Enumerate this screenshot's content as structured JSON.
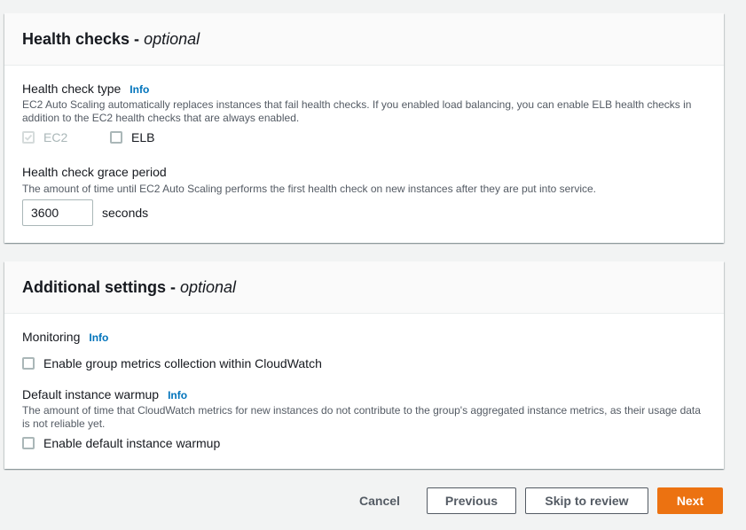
{
  "health_checks": {
    "title": "Health checks - ",
    "title_optional": "optional",
    "type_label": "Health check type",
    "type_info": "Info",
    "type_desc": "EC2 Auto Scaling automatically replaces instances that fail health checks. If you enabled load balancing, you can enable ELB health checks in addition to the EC2 health checks that are always enabled.",
    "ec2_label": "EC2",
    "ec2_checked": true,
    "elb_label": "ELB",
    "elb_checked": false,
    "grace_label": "Health check grace period",
    "grace_desc": "The amount of time until EC2 Auto Scaling performs the first health check on new instances after they are put into service.",
    "grace_value": "3600",
    "grace_unit": "seconds"
  },
  "additional_settings": {
    "title": "Additional settings - ",
    "title_optional": "optional",
    "monitoring_label": "Monitoring",
    "monitoring_info": "Info",
    "metrics_label": "Enable group metrics collection within CloudWatch",
    "metrics_checked": false,
    "warmup_label": "Default instance warmup",
    "warmup_info": "Info",
    "warmup_desc": "The amount of time that CloudWatch metrics for new instances do not contribute to the group's aggregated instance metrics, as their usage data is not reliable yet.",
    "warmup_cb_label": "Enable default instance warmup",
    "warmup_checked": false
  },
  "footer": {
    "cancel": "Cancel",
    "previous": "Previous",
    "skip": "Skip to review",
    "next": "Next"
  },
  "colors": {
    "primary": "#ec7211",
    "link": "#0073bb"
  }
}
